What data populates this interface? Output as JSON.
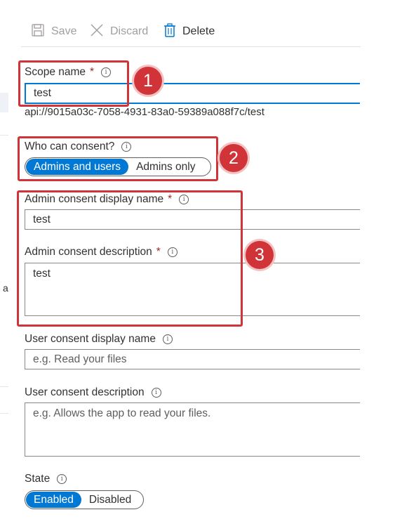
{
  "toolbar": {
    "save_label": "Save",
    "discard_label": "Discard",
    "delete_label": "Delete"
  },
  "left_panel": {
    "partial_char": "a"
  },
  "scope_name": {
    "label": "Scope name",
    "required_marker": "*",
    "value": "test",
    "uri": "api://9015a03c-7058-4931-83a0-59389a088f7c/test"
  },
  "consent": {
    "label": "Who can consent?",
    "options": [
      "Admins and users",
      "Admins only"
    ],
    "selected": "Admins and users"
  },
  "admin_display": {
    "label": "Admin consent display name",
    "required_marker": "*",
    "value": "test"
  },
  "admin_description": {
    "label": "Admin consent description",
    "required_marker": "*",
    "value": "test"
  },
  "user_display": {
    "label": "User consent display name",
    "placeholder": "e.g. Read your files"
  },
  "user_description": {
    "label": "User consent description",
    "placeholder": "e.g. Allows the app to read your files."
  },
  "state": {
    "label": "State",
    "options": [
      "Enabled",
      "Disabled"
    ],
    "selected": "Enabled"
  },
  "info_glyph": "i",
  "callouts": [
    "1",
    "2",
    "3"
  ],
  "colors": {
    "accent": "#0078d4",
    "callout_red": "#d13438",
    "required_red": "#a4262c",
    "disabled_text": "#a19f9d"
  }
}
